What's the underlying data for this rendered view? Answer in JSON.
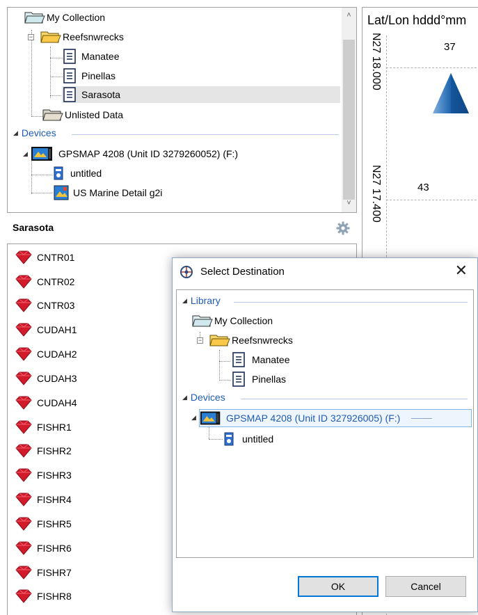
{
  "tree": {
    "items": [
      {
        "label": "My Collection"
      },
      {
        "label": "Reefsnwrecks"
      },
      {
        "label": "Manatee"
      },
      {
        "label": "Pinellas"
      },
      {
        "label": "Sarasota"
      },
      {
        "label": "Unlisted Data"
      }
    ],
    "devices_header": "Devices",
    "device": {
      "label": "GPSMAP 4208 (Unit ID 3279260052) (F:)"
    },
    "device_items": [
      {
        "label": "untitled"
      },
      {
        "label": "US Marine Detail g2i"
      }
    ]
  },
  "list": {
    "title": "Sarasota",
    "waypoints": [
      "CNTR01",
      "CNTR02",
      "CNTR03",
      "CUDAH1",
      "CUDAH2",
      "CUDAH3",
      "CUDAH4",
      "FISHR1",
      "FISHR2",
      "FISHR3",
      "FISHR4",
      "FISHR5",
      "FISHR6",
      "FISHR7",
      "FISHR8"
    ]
  },
  "map": {
    "title": "Lat/Lon hddd°mm",
    "lat1": "N27 18.000",
    "lat2": "N27 17.400",
    "depth1": "37",
    "depth2": "43"
  },
  "dialog": {
    "title": "Select Destination",
    "library_header": "Library",
    "library_items": [
      {
        "label": "My Collection"
      },
      {
        "label": "Reefsnwrecks"
      },
      {
        "label": "Manatee"
      },
      {
        "label": "Pinellas"
      }
    ],
    "devices_header": "Devices",
    "device_label": "GPSMAP 4208 (Unit ID 327926005) (F:)",
    "device_items": [
      {
        "label": "untitled"
      }
    ],
    "ok": "OK",
    "cancel": "Cancel"
  },
  "colors": {
    "accent": "#1e5bb5",
    "waypoint": "#d11a2a",
    "selection": "#e5e5e5"
  }
}
